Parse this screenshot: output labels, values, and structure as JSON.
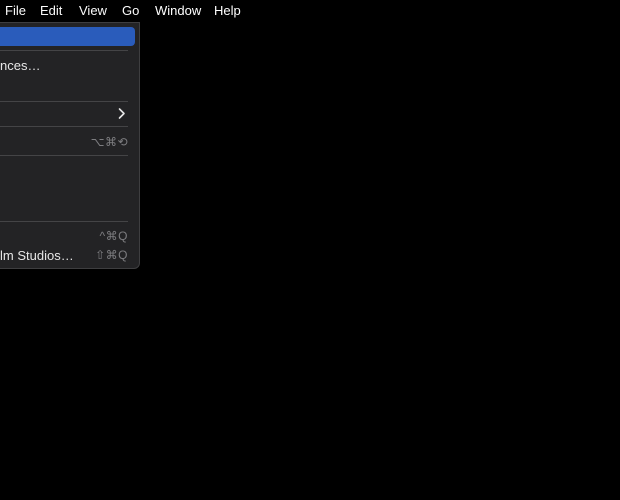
{
  "menubar": {
    "items": [
      {
        "label": "File"
      },
      {
        "label": "Edit"
      },
      {
        "label": "View"
      },
      {
        "label": "Go"
      },
      {
        "label": "Window"
      },
      {
        "label": "Help"
      }
    ]
  },
  "app_menu": {
    "items": [
      {
        "label": "nces…",
        "shortcut": ""
      },
      {
        "label": "",
        "shortcut": "⌥⌘⟲"
      },
      {
        "label": "",
        "shortcut": "^⌘Q"
      },
      {
        "label": "lm Studios…",
        "shortcut": "⇧⌘Q"
      }
    ]
  },
  "colors": {
    "highlight": "#2a5cbb",
    "menu_bg": "#232325",
    "background": "#000000"
  }
}
